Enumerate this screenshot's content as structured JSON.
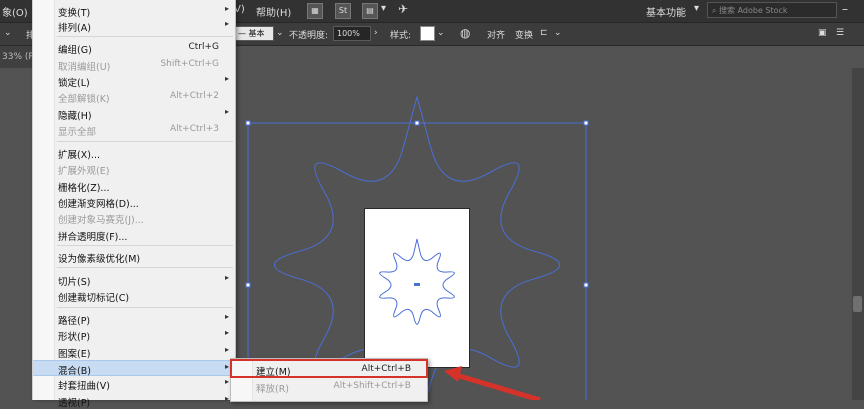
{
  "menubar": {
    "object_menu": "象(O)",
    "help_menu": "帮助(H)",
    "extra_menu": "V)",
    "stock_icon": "St",
    "workspace": "基本功能",
    "search_placeholder": "搜索 Adobe Stock"
  },
  "control_bar": {
    "stroke_style": "基本",
    "opacity_label": "不透明度:",
    "opacity_value": "100%",
    "style_label": "样式:",
    "align_label": "对齐",
    "transform_label": "变换",
    "left_cut": "排"
  },
  "doc_tab": {
    "label": "33% (R"
  },
  "menu": {
    "items": [
      {
        "label": "变换(T)",
        "submenu": true,
        "enabled": true
      },
      {
        "label": "排列(A)",
        "submenu": true,
        "enabled": true
      },
      {
        "label": "编组(G)",
        "shortcut": "Ctrl+G",
        "enabled": true
      },
      {
        "label": "取消编组(U)",
        "shortcut": "Shift+Ctrl+G",
        "enabled": false
      },
      {
        "label": "锁定(L)",
        "submenu": true,
        "enabled": true
      },
      {
        "label": "全部解锁(K)",
        "shortcut": "Alt+Ctrl+2",
        "enabled": false
      },
      {
        "label": "隐藏(H)",
        "submenu": true,
        "enabled": true
      },
      {
        "label": "显示全部",
        "shortcut": "Alt+Ctrl+3",
        "enabled": false
      },
      {
        "label": "扩展(X)...",
        "enabled": true
      },
      {
        "label": "扩展外观(E)",
        "enabled": false
      },
      {
        "label": "栅格化(Z)...",
        "enabled": true
      },
      {
        "label": "创建渐变网格(D)...",
        "enabled": true
      },
      {
        "label": "创建对象马赛克(J)...",
        "enabled": false
      },
      {
        "label": "拼合透明度(F)...",
        "enabled": true
      },
      {
        "label": "设为像素级优化(M)",
        "enabled": true
      },
      {
        "label": "切片(S)",
        "submenu": true,
        "enabled": true
      },
      {
        "label": "创建裁切标记(C)",
        "enabled": true
      },
      {
        "label": "路径(P)",
        "submenu": true,
        "enabled": true
      },
      {
        "label": "形状(P)",
        "submenu": true,
        "enabled": true
      },
      {
        "label": "图案(E)",
        "submenu": true,
        "enabled": true
      },
      {
        "label": "混合(B)",
        "submenu": true,
        "enabled": true
      },
      {
        "label": "封套扭曲(V)",
        "submenu": true,
        "enabled": true
      },
      {
        "label": "透视(P)",
        "submenu": true,
        "enabled": true
      }
    ]
  },
  "blend_submenu": {
    "items": [
      {
        "label": "建立(M)",
        "shortcut": "Alt+Ctrl+B",
        "enabled": true
      },
      {
        "label": "释放(R)",
        "shortcut": "Alt+Shift+Ctrl+B",
        "enabled": false
      }
    ]
  },
  "colors": {
    "selection_blue": "#4a6fd6",
    "highlight_red": "#d5332a"
  }
}
